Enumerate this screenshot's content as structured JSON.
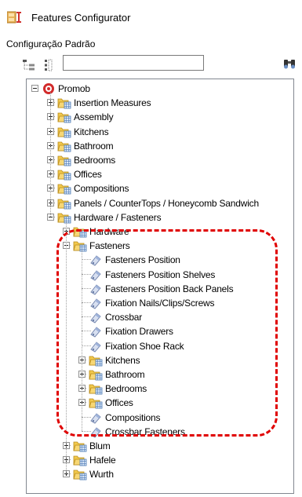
{
  "window": {
    "title": "Features Configurator",
    "icon": "features-configurator-icon"
  },
  "subtitle": "Configuração Padrão",
  "toolbar": {
    "search_value": "",
    "search_icon": "binoculars-icon"
  },
  "tree": [
    {
      "label": "Promob",
      "level": 0,
      "expander": "minus",
      "icon": "promob-icon"
    },
    {
      "label": "Insertion Measures",
      "level": 1,
      "expander": "plus",
      "icon": "folder-icon"
    },
    {
      "label": "Assembly",
      "level": 1,
      "expander": "plus",
      "icon": "folder-icon"
    },
    {
      "label": "Kitchens",
      "level": 1,
      "expander": "plus",
      "icon": "folder-icon"
    },
    {
      "label": "Bathroom",
      "level": 1,
      "expander": "plus",
      "icon": "folder-icon"
    },
    {
      "label": "Bedrooms",
      "level": 1,
      "expander": "plus",
      "icon": "folder-icon"
    },
    {
      "label": "Offices",
      "level": 1,
      "expander": "plus",
      "icon": "folder-icon"
    },
    {
      "label": "Compositions",
      "level": 1,
      "expander": "plus",
      "icon": "folder-icon"
    },
    {
      "label": "Panels / CounterTops / Honeycomb Sandwich",
      "level": 1,
      "expander": "plus",
      "icon": "folder-icon"
    },
    {
      "label": "Hardware / Fasteners",
      "level": 1,
      "expander": "minus",
      "icon": "folder-icon"
    },
    {
      "label": "Hardware",
      "level": 2,
      "expander": "plus",
      "icon": "folder-icon"
    },
    {
      "label": "Fasteners",
      "level": 2,
      "expander": "minus",
      "icon": "folder-icon"
    },
    {
      "label": "Fasteners Position",
      "level": 3,
      "expander": "none",
      "icon": "feature-tag-icon"
    },
    {
      "label": "Fasteners Position Shelves",
      "level": 3,
      "expander": "none",
      "icon": "feature-tag-icon"
    },
    {
      "label": "Fasteners Position Back Panels",
      "level": 3,
      "expander": "none",
      "icon": "feature-tag-icon"
    },
    {
      "label": "Fixation Nails/Clips/Screws",
      "level": 3,
      "expander": "none",
      "icon": "feature-tag-icon"
    },
    {
      "label": "Crossbar",
      "level": 3,
      "expander": "none",
      "icon": "feature-tag-icon"
    },
    {
      "label": "Fixation Drawers",
      "level": 3,
      "expander": "none",
      "icon": "feature-tag-icon"
    },
    {
      "label": "Fixation Shoe Rack",
      "level": 3,
      "expander": "none",
      "icon": "feature-tag-icon"
    },
    {
      "label": "Kitchens",
      "level": 3,
      "expander": "plus",
      "icon": "folder-icon"
    },
    {
      "label": "Bathroom",
      "level": 3,
      "expander": "plus",
      "icon": "folder-icon"
    },
    {
      "label": "Bedrooms",
      "level": 3,
      "expander": "plus",
      "icon": "folder-icon"
    },
    {
      "label": "Offices",
      "level": 3,
      "expander": "plus",
      "icon": "folder-icon"
    },
    {
      "label": "Compositions",
      "level": 3,
      "expander": "none",
      "icon": "feature-tag-icon"
    },
    {
      "label": "Crossbar Fasteners",
      "level": 3,
      "expander": "none",
      "icon": "feature-tag-icon"
    },
    {
      "label": "Blum",
      "level": 2,
      "expander": "plus",
      "icon": "folder-icon"
    },
    {
      "label": "Hafele",
      "level": 2,
      "expander": "plus",
      "icon": "folder-icon"
    },
    {
      "label": "Wurth",
      "level": 2,
      "expander": "plus",
      "icon": "folder-icon"
    }
  ],
  "colors": {
    "highlight": "#e00000",
    "folder": "#f0c24a",
    "tree_border": "#828790"
  }
}
